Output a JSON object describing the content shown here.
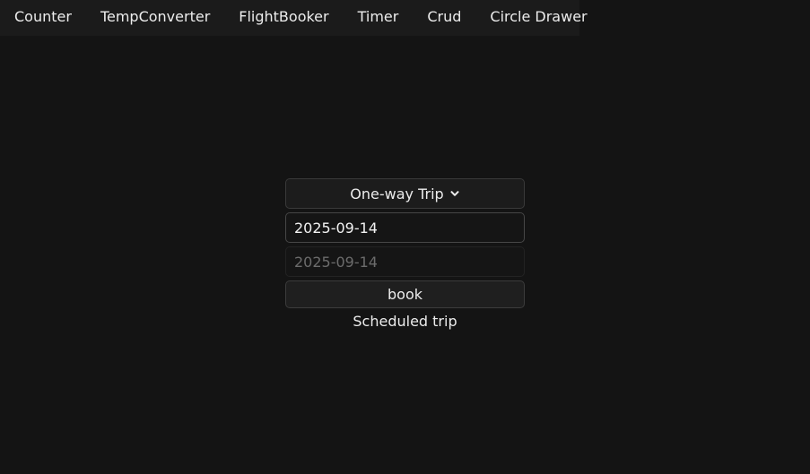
{
  "tabs": [
    {
      "label": "Counter"
    },
    {
      "label": "TempConverter"
    },
    {
      "label": "FlightBooker"
    },
    {
      "label": "Timer"
    },
    {
      "label": "Crud"
    },
    {
      "label": "Circle Drawer"
    }
  ],
  "flight": {
    "trip_type": "One-way Trip",
    "trip_icon": "chevron-down-icon",
    "departure_date": "2025-09-14",
    "return_date": "2025-09-14",
    "book_label": "book",
    "status": "Scheduled trip"
  },
  "colors": {
    "background": "#141414",
    "tabbar": "#1b1b1b",
    "text": "#ececec",
    "disabled_text": "#6c6c6c"
  }
}
